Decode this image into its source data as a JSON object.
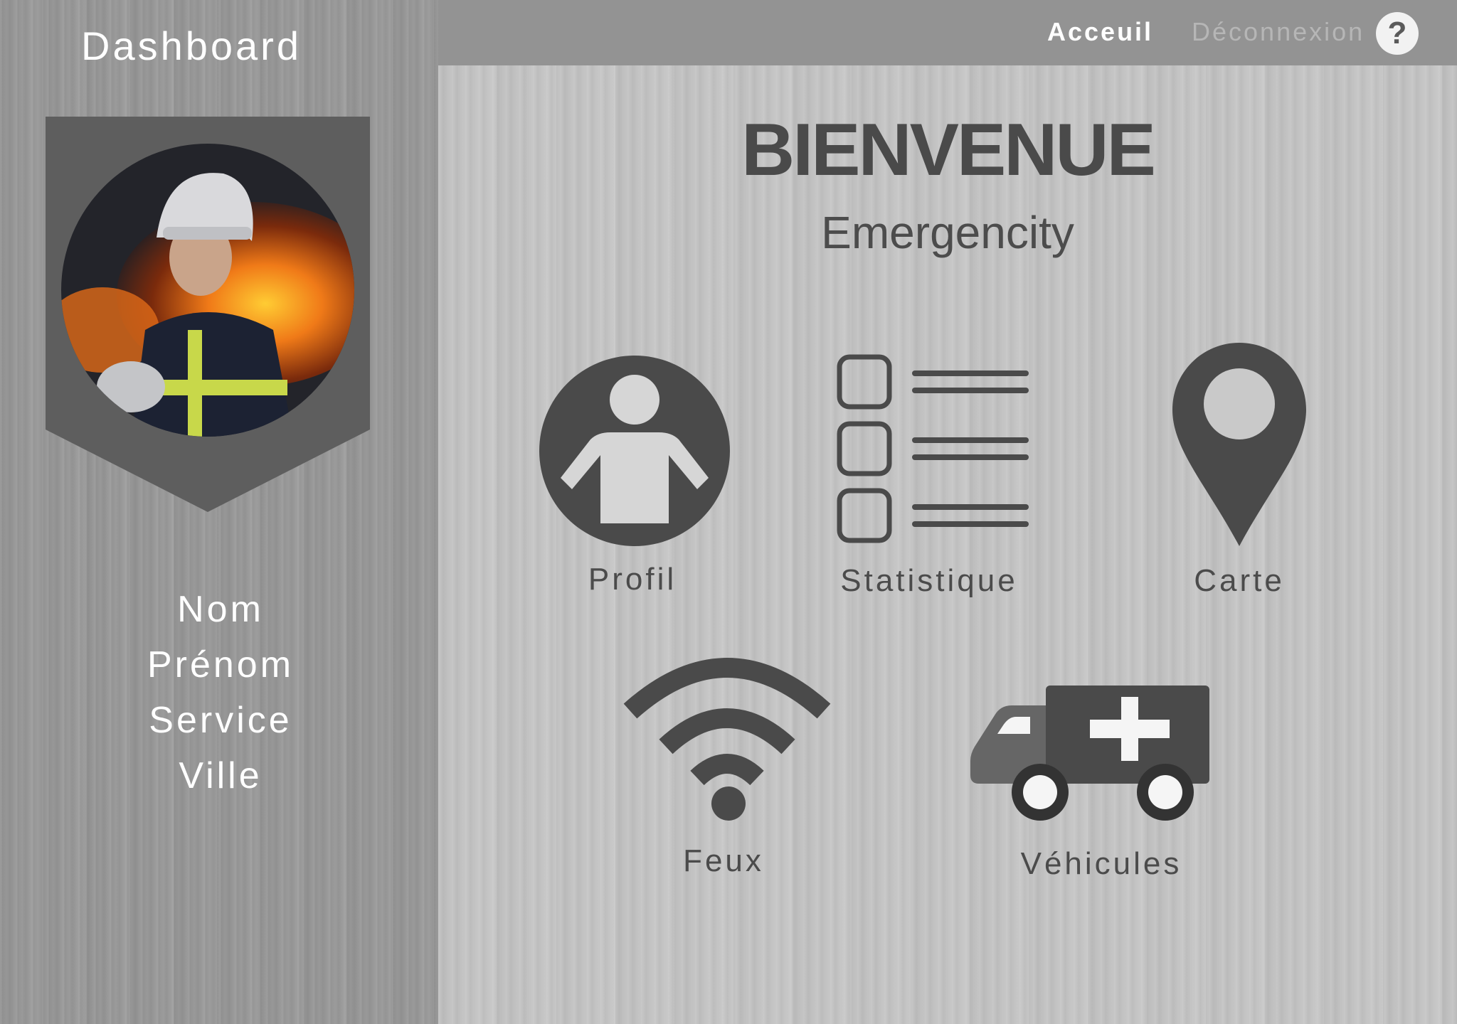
{
  "sidebar": {
    "title": "Dashboard",
    "profile_image": "firefighter-photo",
    "info": [
      "Nom",
      "Prénom",
      "Service",
      "Ville"
    ]
  },
  "topbar": {
    "nav": [
      {
        "label": "Acceuil",
        "active": true
      },
      {
        "label": "Déconnexion",
        "active": false
      }
    ],
    "help_label": "?"
  },
  "main": {
    "title": "BIENVENUE",
    "subtitle": "Emergencity",
    "tiles": [
      {
        "label": "Profil",
        "icon": "person-icon"
      },
      {
        "label": "Statistique",
        "icon": "checklist-icon"
      },
      {
        "label": "Carte",
        "icon": "map-pin-icon"
      },
      {
        "label": "Feux",
        "icon": "wifi-signal-icon"
      },
      {
        "label": "Véhicules",
        "icon": "ambulance-icon"
      }
    ]
  },
  "colors": {
    "icon": "#4a4a4a",
    "sidebar_bg": "#9a9a9a",
    "main_bg": "#c3c3c3",
    "badge": "#5e5e5e",
    "text_light": "#ffffff"
  }
}
